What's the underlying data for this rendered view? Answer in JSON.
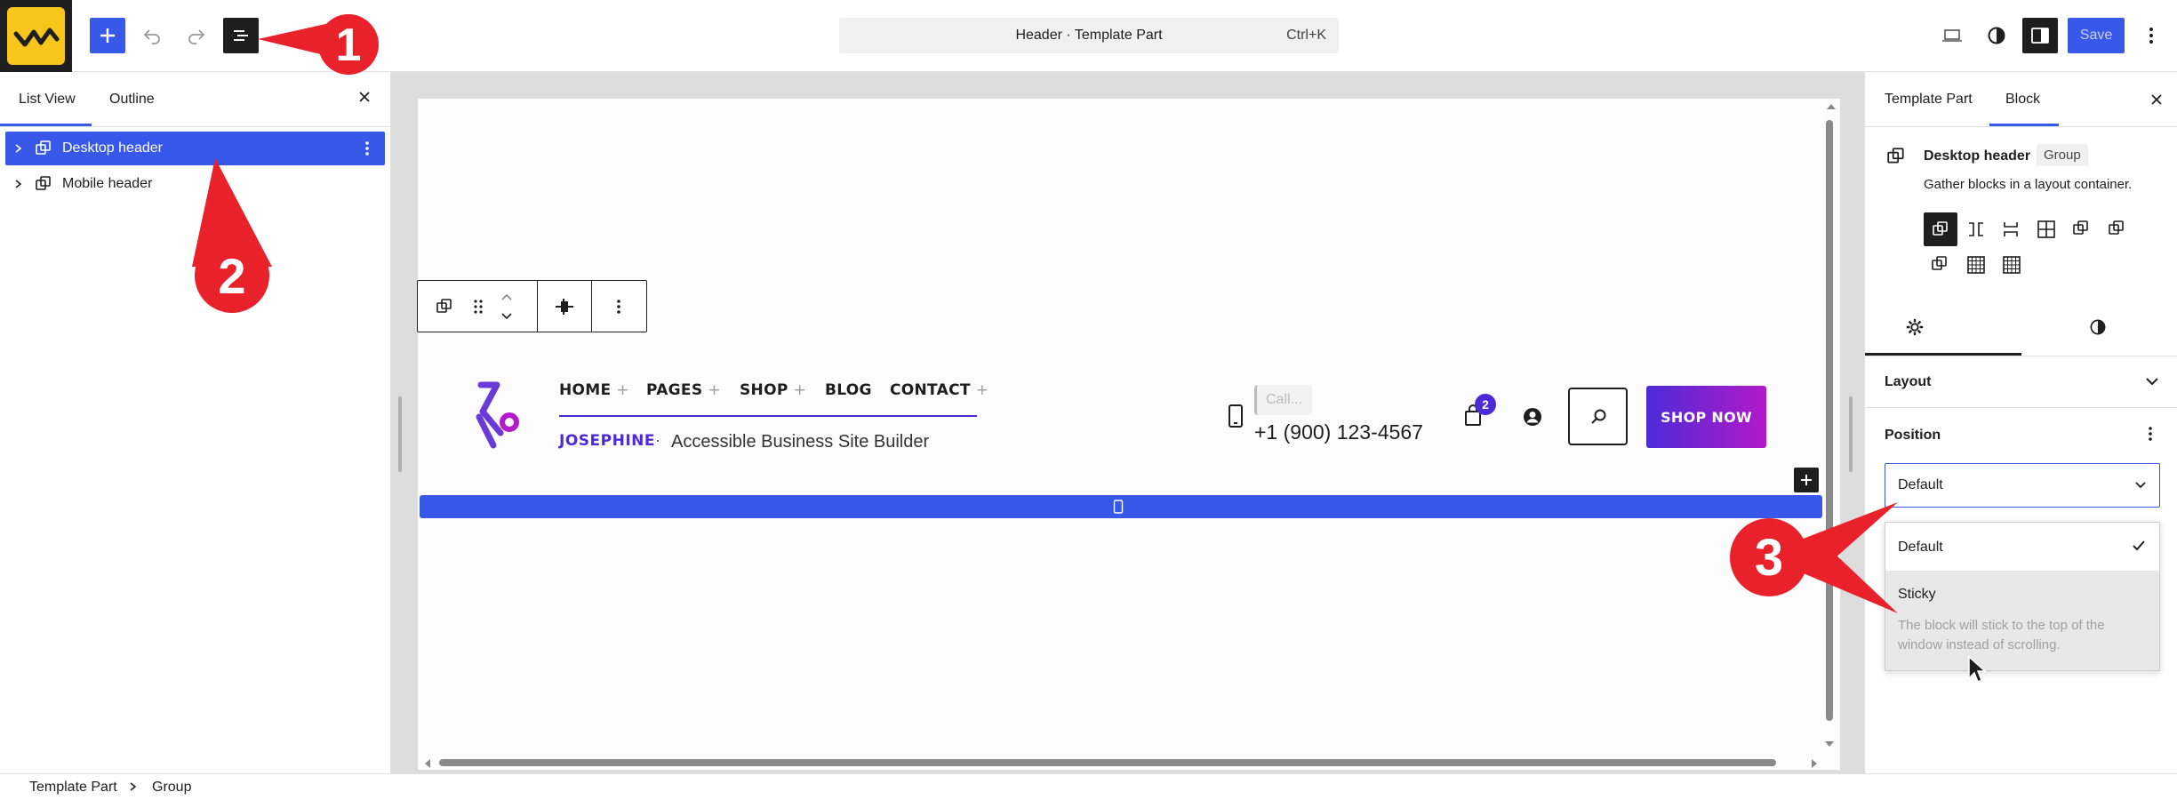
{
  "topbar": {
    "command_title": "Header · Template Part",
    "command_shortcut": "Ctrl+K",
    "save_label": "Save"
  },
  "left_panel": {
    "tabs": [
      "List View",
      "Outline"
    ],
    "items": [
      {
        "label": "Desktop header",
        "selected": true
      },
      {
        "label": "Mobile header",
        "selected": false
      }
    ]
  },
  "header_preview": {
    "nav": [
      "HOME",
      "PAGES",
      "SHOP",
      "BLOG",
      "CONTACT"
    ],
    "nav_has_plus": [
      true,
      true,
      true,
      false,
      true
    ],
    "site_name": "JOSEPHINE",
    "separator": "·",
    "tagline": "Accessible Business Site Builder",
    "call_label": "Call...",
    "phone": "+1 (900) 123-4567",
    "cart_count": "2",
    "cta": "SHOP NOW"
  },
  "right_panel": {
    "tabs": [
      "Template Part",
      "Block"
    ],
    "block_name": "Desktop header",
    "block_badge": "Group",
    "block_description": "Gather blocks in a layout container.",
    "sections": {
      "layout": "Layout",
      "position": "Position"
    },
    "position_select_value": "Default",
    "dropdown_options": [
      {
        "label": "Default",
        "checked": true
      },
      {
        "label": "Sticky",
        "description": "The block will stick to the top of the window instead of scrolling."
      }
    ]
  },
  "breadcrumb": [
    "Template Part",
    "Group"
  ],
  "annotations": [
    "1",
    "2",
    "3"
  ],
  "colors": {
    "accent": "#3858e9",
    "brand_purple": "#6a3ad8",
    "cta_gradient_start": "#4c2bd6",
    "cta_gradient_end": "#b31ac9",
    "annotation_red": "#e8212a"
  }
}
